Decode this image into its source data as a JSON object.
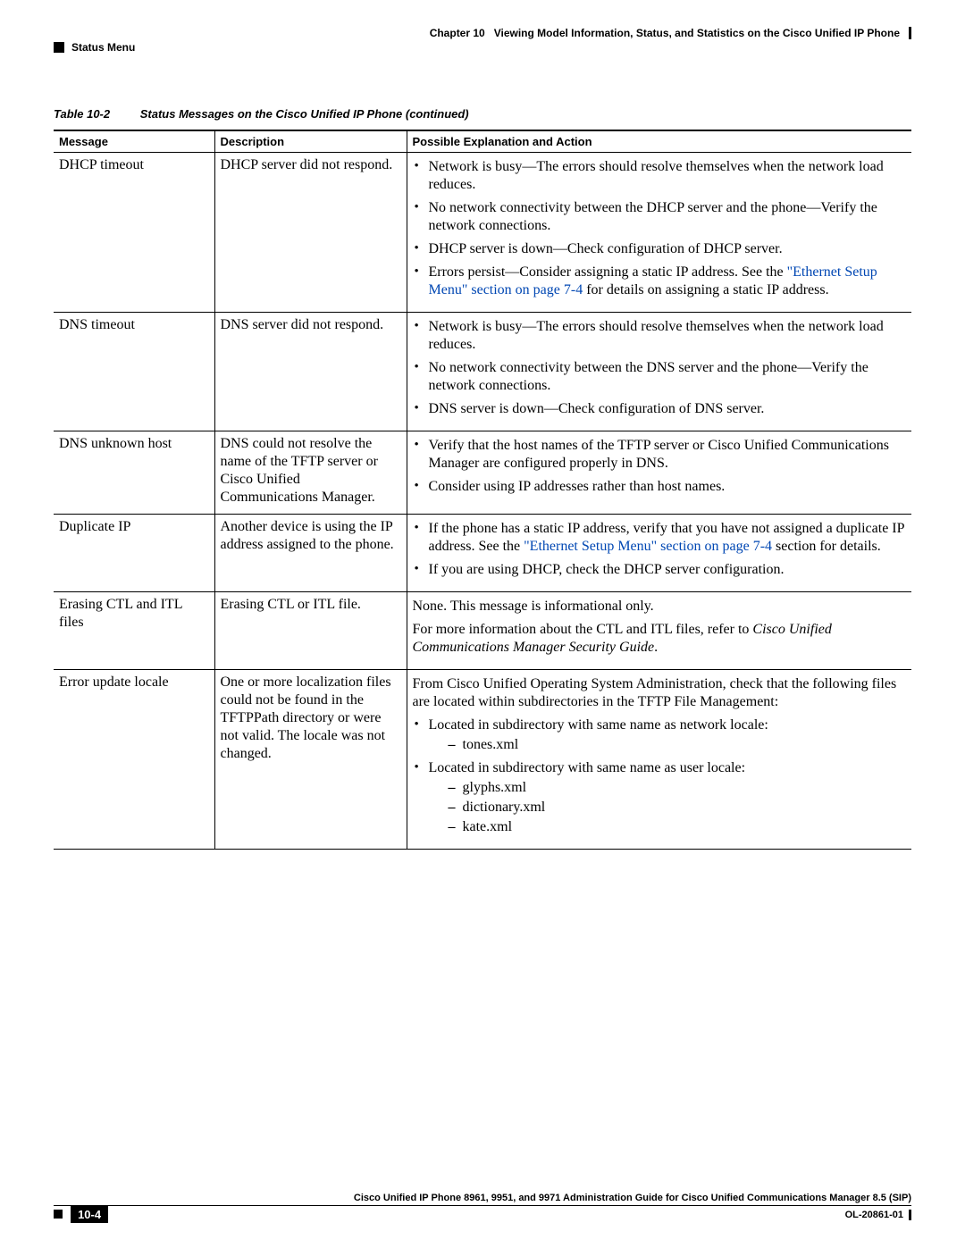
{
  "header": {
    "chapter_label": "Chapter 10",
    "chapter_title": "Viewing Model Information, Status, and Statistics on the Cisco Unified IP Phone",
    "section_label": "Status Menu"
  },
  "table_caption": {
    "number": "Table 10-2",
    "title": "Status Messages on the Cisco Unified IP Phone (continued)"
  },
  "columns": {
    "c1": "Message",
    "c2": "Description",
    "c3": "Possible Explanation and Action"
  },
  "rows": {
    "dhcp_timeout": {
      "msg": "DHCP timeout",
      "desc": "DHCP server did not respond.",
      "b1": "Network is busy—The errors should resolve themselves when the network load reduces.",
      "b2": "No network connectivity between the DHCP server and the phone—Verify the network connections.",
      "b3": "DHCP server is down—Check configuration of DHCP server.",
      "b4_pre": "Errors persist—Consider assigning a static IP address. See the ",
      "b4_link": "\"Ethernet Setup Menu\" section on page 7-4",
      "b4_post": " for details on assigning a static IP address."
    },
    "dns_timeout": {
      "msg": "DNS timeout",
      "desc": "DNS server did not respond.",
      "b1": "Network is busy—The errors should resolve themselves when the network load reduces.",
      "b2": "No network connectivity between the DNS server and the phone—Verify the network connections.",
      "b3": "DNS server is down—Check configuration of DNS server."
    },
    "dns_unknown": {
      "msg": "DNS unknown host",
      "desc": "DNS could not resolve the name of the TFTP server or Cisco Unified Communications Manager.",
      "b1": "Verify that the host names of the TFTP server or Cisco Unified Communications Manager are configured properly in DNS.",
      "b2": "Consider using IP addresses rather than host names."
    },
    "dup_ip": {
      "msg": "Duplicate IP",
      "desc": "Another device is using the IP address assigned to the phone.",
      "b1_pre": "If the phone has a static IP address, verify that you have not assigned a duplicate IP address. See the ",
      "b1_link": "\"Ethernet Setup Menu\" section on page 7-4",
      "b1_post": " section for details.",
      "b2": "If you are using DHCP, check the DHCP server configuration."
    },
    "erasing": {
      "msg": "Erasing CTL and ITL files",
      "desc": "Erasing CTL or ITL file.",
      "p1": "None. This message is informational only.",
      "p2_pre": "For more information about the CTL and ITL files, refer to ",
      "p2_italic": "Cisco Unified Communications Manager Security Guide",
      "p2_post": "."
    },
    "error_locale": {
      "msg": "Error update locale",
      "desc": "One or more localization files could not be found in the TFTPPath directory or were not valid. The locale was not changed.",
      "p1": "From Cisco Unified Operating System Administration, check that the following files are located within subdirectories in the TFTP File Management:",
      "b1": "Located in subdirectory with same name as network locale:",
      "b1_d1": "tones.xml",
      "b2": "Located in subdirectory with same name as user locale:",
      "b2_d1": "glyphs.xml",
      "b2_d2": "dictionary.xml",
      "b2_d3": "kate.xml"
    }
  },
  "footer": {
    "guide_title": "Cisco Unified IP Phone 8961, 9951, and 9971 Administration Guide for Cisco Unified Communications Manager 8.5 (SIP)",
    "page_number": "10-4",
    "doc_id": "OL-20861-01"
  }
}
